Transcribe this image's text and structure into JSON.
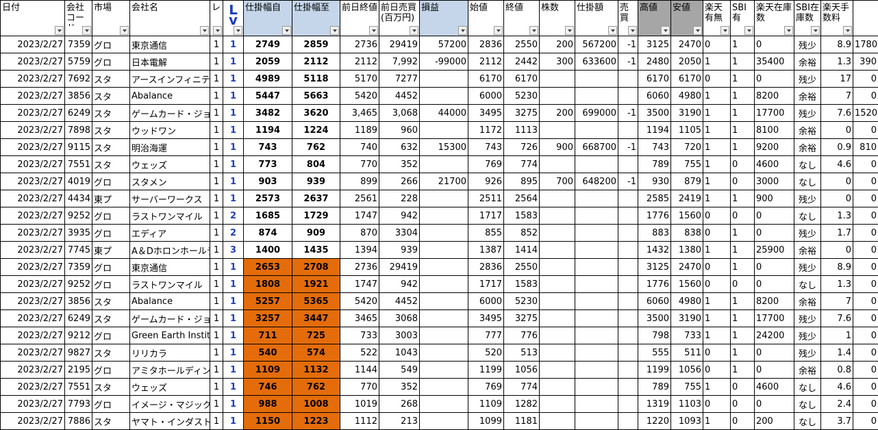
{
  "sheet": {
    "headers": [
      "日付",
      "会社コード",
      "市場",
      "会社名",
      "レ",
      "Lv",
      "仕掛幅自",
      "仕掛幅至",
      "前日終値",
      "前日売買(百万円)",
      "損益",
      "始値",
      "終値",
      "株数",
      "仕掛額",
      "売買",
      "高値",
      "安値",
      "楽天有無",
      "SBI有",
      "楽天在庫数",
      "SBI在庫数",
      "楽天手数料",
      ""
    ],
    "highlight_color": "#e46c0a",
    "rows": [
      [
        "2023/2/27",
        "7359",
        "グロ",
        "東京通信",
        "1",
        "1",
        "2749",
        "2859",
        "2736",
        "29419",
        "57200",
        "2836",
        "2550",
        "200",
        "567200",
        "-1",
        "3125",
        "2470",
        "0",
        "1",
        "0",
        "残少",
        "8.9",
        "1780"
      ],
      [
        "2023/2/27",
        "5759",
        "グロ",
        "日本電解",
        "1",
        "1",
        "2059",
        "2112",
        "2112",
        "7,992",
        "-99000",
        "2112",
        "2442",
        "300",
        "633600",
        "-1",
        "2480",
        "2050",
        "1",
        "1",
        "35400",
        "余裕",
        "1.3",
        "390"
      ],
      [
        "2023/2/27",
        "7692",
        "スタ",
        "アースインフィニティ",
        "1",
        "1",
        "4989",
        "5118",
        "5170",
        "7277",
        "",
        "6170",
        "6170",
        "",
        "",
        "",
        "6170",
        "6170",
        "0",
        "1",
        "0",
        "残少",
        "17",
        "0"
      ],
      [
        "2023/2/27",
        "3856",
        "スタ",
        "Abalance",
        "1",
        "1",
        "5447",
        "5663",
        "5420",
        "4452",
        "",
        "6000",
        "5230",
        "",
        "",
        "",
        "6060",
        "4980",
        "1",
        "1",
        "8200",
        "余裕",
        "7",
        "0"
      ],
      [
        "2023/2/27",
        "6249",
        "スタ",
        "ゲームカード・ジョイコ",
        "1",
        "1",
        "3482",
        "3620",
        "3,465",
        "3,068",
        "44000",
        "3495",
        "3275",
        "200",
        "699000",
        "-1",
        "3500",
        "3190",
        "1",
        "1",
        "17700",
        "残少",
        "7.6",
        "1520"
      ],
      [
        "2023/2/27",
        "7898",
        "スタ",
        "ウッドワン",
        "1",
        "1",
        "1194",
        "1224",
        "1189",
        "960",
        "",
        "1172",
        "1113",
        "",
        "",
        "",
        "1194",
        "1105",
        "1",
        "1",
        "8100",
        "余裕",
        "0",
        "0"
      ],
      [
        "2023/2/27",
        "9115",
        "スタ",
        "明治海運",
        "1",
        "1",
        "743",
        "762",
        "740",
        "632",
        "15300",
        "743",
        "726",
        "900",
        "668700",
        "-1",
        "743",
        "720",
        "1",
        "1",
        "9200",
        "余裕",
        "0.9",
        "810"
      ],
      [
        "2023/2/27",
        "7551",
        "スタ",
        "ウェッズ",
        "1",
        "1",
        "773",
        "804",
        "770",
        "352",
        "",
        "769",
        "774",
        "",
        "",
        "",
        "789",
        "755",
        "1",
        "0",
        "4600",
        "なし",
        "4.6",
        "0"
      ],
      [
        "2023/2/27",
        "4019",
        "グロ",
        "スタメン",
        "1",
        "1",
        "903",
        "939",
        "899",
        "266",
        "21700",
        "926",
        "895",
        "700",
        "648200",
        "-1",
        "930",
        "879",
        "1",
        "0",
        "3000",
        "なし",
        "0",
        "0"
      ],
      [
        "2023/2/27",
        "4434",
        "東プ",
        "サーバーワークス",
        "1",
        "1",
        "2573",
        "2637",
        "2561",
        "228",
        "",
        "2511",
        "2564",
        "",
        "",
        "",
        "2585",
        "2419",
        "1",
        "1",
        "900",
        "残少",
        "0",
        "0"
      ],
      [
        "2023/2/27",
        "9252",
        "グロ",
        "ラストワンマイル",
        "1",
        "2",
        "1685",
        "1729",
        "1747",
        "942",
        "",
        "1717",
        "1583",
        "",
        "",
        "",
        "1776",
        "1560",
        "0",
        "0",
        "0",
        "なし",
        "1.3",
        "0"
      ],
      [
        "2023/2/27",
        "3935",
        "グロ",
        "エディア",
        "1",
        "2",
        "874",
        "909",
        "870",
        "3304",
        "",
        "855",
        "852",
        "",
        "",
        "",
        "883",
        "838",
        "0",
        "1",
        "0",
        "残少",
        "1.7",
        "0"
      ],
      [
        "2023/2/27",
        "7745",
        "東プ",
        "A＆Dホロンホールディングス",
        "1",
        "3",
        "1400",
        "1435",
        "1394",
        "939",
        "",
        "1387",
        "1414",
        "",
        "",
        "",
        "1432",
        "1380",
        "1",
        "1",
        "25900",
        "余裕",
        "0",
        "0"
      ],
      [
        "2023/2/27",
        "7359",
        "グロ",
        "東京通信",
        "1",
        "1",
        "2653",
        "2708",
        "2736",
        "29419",
        "",
        "2836",
        "2550",
        "",
        "",
        "",
        "3125",
        "2470",
        "0",
        "1",
        "0",
        "残少",
        "8.9",
        "0"
      ],
      [
        "2023/2/27",
        "9252",
        "グロ",
        "ラストワンマイル",
        "1",
        "1",
        "1808",
        "1921",
        "1747",
        "942",
        "",
        "1717",
        "1583",
        "",
        "",
        "",
        "1776",
        "1560",
        "0",
        "0",
        "0",
        "なし",
        "1.3",
        "0"
      ],
      [
        "2023/2/27",
        "3856",
        "スタ",
        "Abalance",
        "1",
        "1",
        "5257",
        "5365",
        "5420",
        "4452",
        "",
        "6000",
        "5230",
        "",
        "",
        "",
        "6060",
        "4980",
        "1",
        "1",
        "8200",
        "余裕",
        "7",
        "0"
      ],
      [
        "2023/2/27",
        "6249",
        "スタ",
        "ゲームカード・ジョイコ",
        "1",
        "1",
        "3257",
        "3447",
        "3465",
        "3068",
        "",
        "3495",
        "3275",
        "",
        "",
        "",
        "3500",
        "3190",
        "1",
        "1",
        "17700",
        "残少",
        "7.6",
        "0"
      ],
      [
        "2023/2/27",
        "9212",
        "グロ",
        "Green Earth Institute",
        "1",
        "1",
        "711",
        "725",
        "733",
        "3003",
        "",
        "777",
        "776",
        "",
        "",
        "",
        "798",
        "733",
        "1",
        "1",
        "24200",
        "残少",
        "1",
        "0"
      ],
      [
        "2023/2/27",
        "9827",
        "スタ",
        "リリカラ",
        "1",
        "1",
        "540",
        "574",
        "522",
        "1043",
        "",
        "520",
        "513",
        "",
        "",
        "",
        "555",
        "511",
        "0",
        "1",
        "0",
        "残少",
        "1.4",
        "0"
      ],
      [
        "2023/2/27",
        "2195",
        "グロ",
        "アミタホールディングス",
        "1",
        "1",
        "1109",
        "1132",
        "1144",
        "549",
        "",
        "1199",
        "1056",
        "",
        "",
        "",
        "1199",
        "1056",
        "0",
        "1",
        "0",
        "余裕",
        "0.8",
        "0"
      ],
      [
        "2023/2/27",
        "7551",
        "スタ",
        "ウェッズ",
        "1",
        "1",
        "746",
        "762",
        "770",
        "352",
        "",
        "769",
        "774",
        "",
        "",
        "",
        "789",
        "755",
        "1",
        "0",
        "4600",
        "なし",
        "4.6",
        "0"
      ],
      [
        "2023/2/27",
        "7793",
        "グロ",
        "イメージ・マジック",
        "1",
        "1",
        "988",
        "1008",
        "1019",
        "268",
        "",
        "1109",
        "1282",
        "",
        "",
        "",
        "1319",
        "1103",
        "0",
        "0",
        "0",
        "なし",
        "2.4",
        "0"
      ],
      [
        "2023/2/27",
        "7886",
        "スタ",
        "ヤマト・インダストリー",
        "1",
        "1",
        "1150",
        "1223",
        "1112",
        "213",
        "",
        "1099",
        "1181",
        "",
        "",
        "",
        "1220",
        "1093",
        "1",
        "0",
        "200",
        "なし",
        "3.7",
        "0"
      ]
    ],
    "highlighted_rows": [
      13,
      14,
      15,
      16,
      17,
      18,
      19,
      20,
      21,
      22
    ]
  }
}
